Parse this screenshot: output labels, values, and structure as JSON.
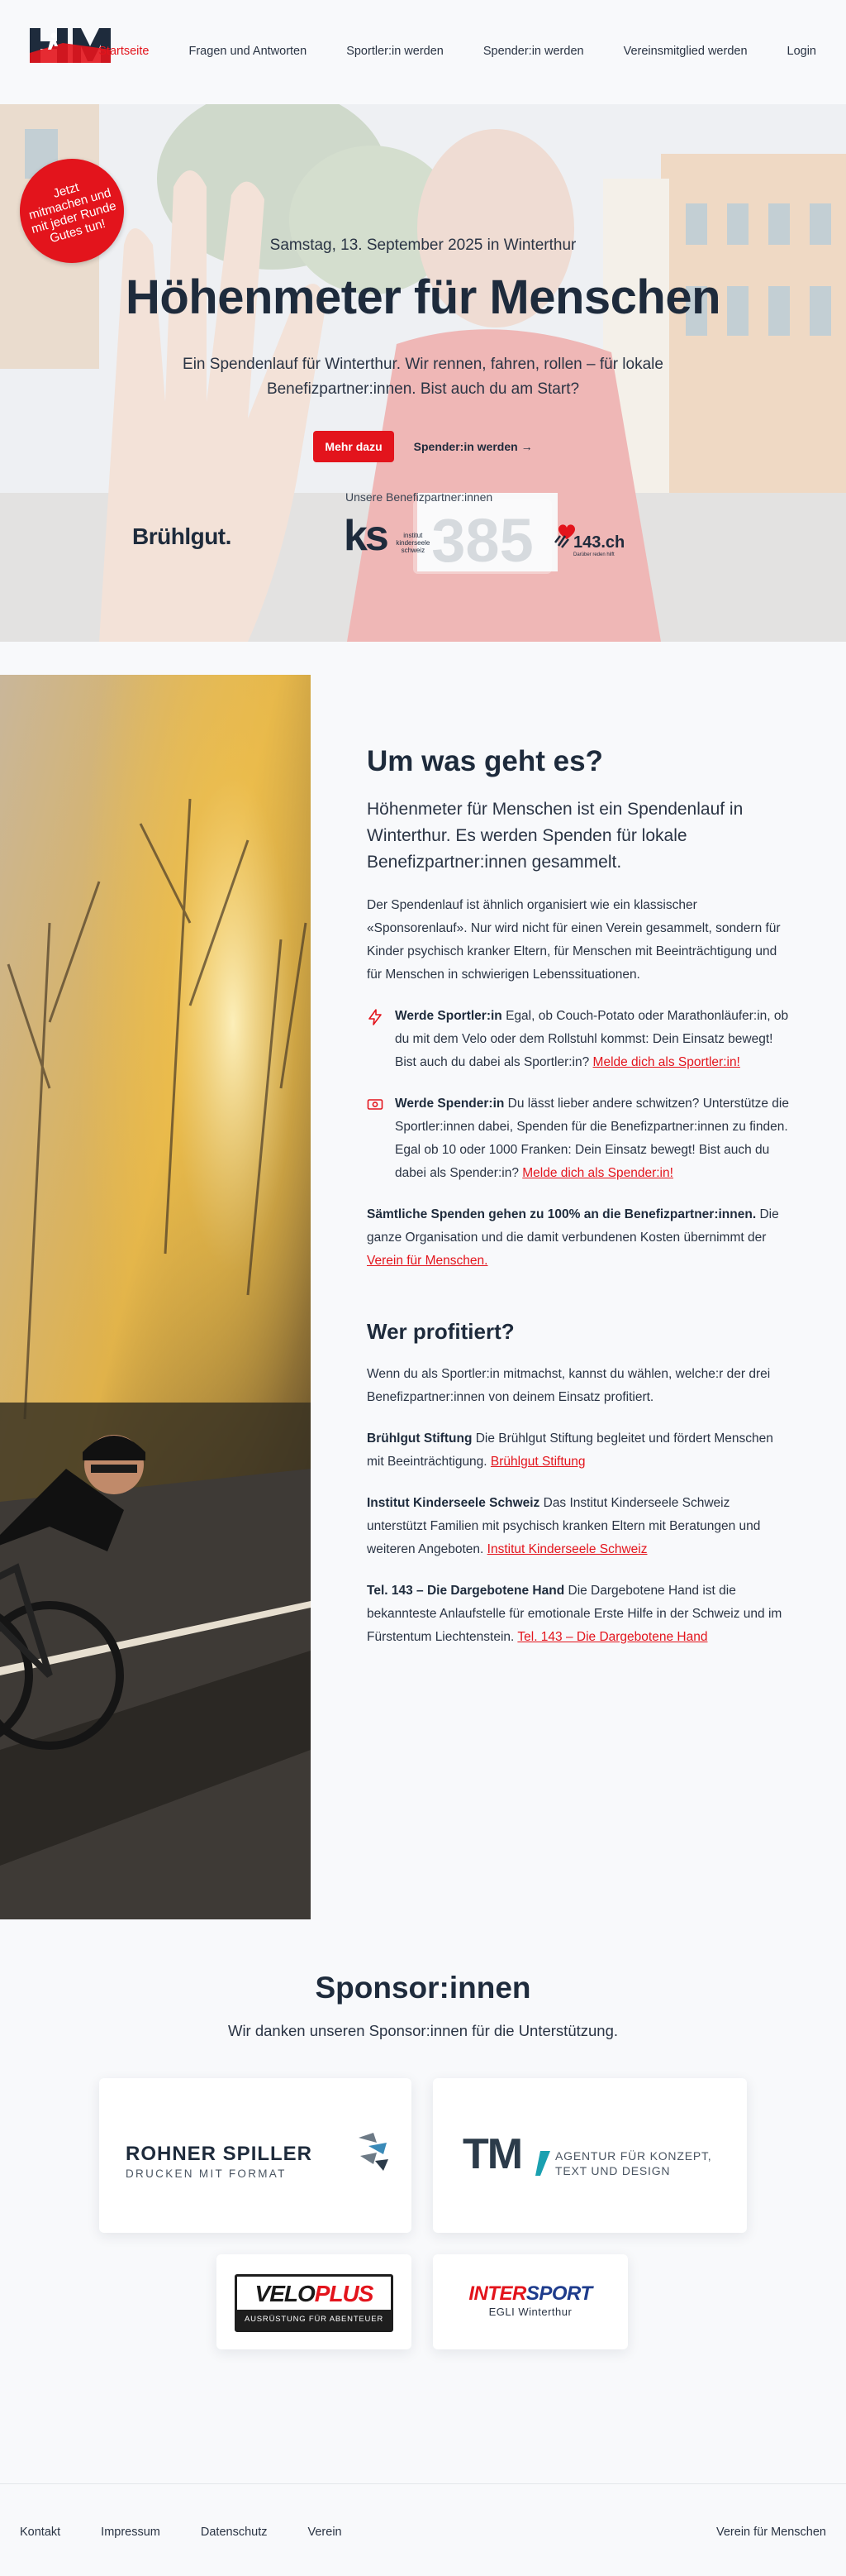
{
  "nav": {
    "logo_icon": "hfm-logo",
    "links": [
      "Startseite",
      "Fragen und Antworten",
      "Sportler:in werden",
      "Spender:in werden",
      "Vereinsmitglied werden",
      "Login"
    ],
    "active": "Startseite",
    "accent": "#e3141c"
  },
  "hero": {
    "badge": "Jetzt mitmachen und mit jeder Runde Gutes tun!",
    "date": "Samstag, 13. September 2025 in Winterthur",
    "title": "Höhenmeter für Menschen",
    "text": "Ein Spendenlauf für Winterthur. Wir rennen, fahren, rollen – für lokale Benefizpartner:innen. Bist auch du am Start?",
    "btn_primary": "Mehr dazu",
    "btn_secondary": "Spender:in werden →",
    "partners_label": "Unsere Benefizpartner:innen",
    "partner_bruehl": "Brühlgut.",
    "partner_ks_mark": "ks",
    "partner_ks_text": "institut kinderseele schweiz",
    "partner_143": "143.ch",
    "partner_143_sub": "Darüber reden hilft",
    "bib_number": "385"
  },
  "about": {
    "title": "Um was geht es?",
    "lead": "Höhenmeter für Menschen ist ein Spendenlauf in Winterthur. Es werden Spenden für lokale Benefizpartner:innen gesammelt.",
    "intro": "Der Spendenlauf ist ähnlich organisiert wie ein klassischer «Sponsorenlauf». Nur wird nicht für einen Verein gesammelt, sondern für Kinder psychisch kranker Eltern, für Menschen mit Beeinträchtigung und für Menschen in schwierigen Lebenssituationen.",
    "feature1_bold": "Werde Sportler:in",
    "feature1_text": " Egal, ob Couch-Potato oder Marathonläufer:in, ob du mit dem Velo oder dem Rollstuhl kommst: Dein Einsatz bewegt! Bist auch du dabei als Sportler:in? ",
    "feature1_link": "Melde dich als Sportler:in!",
    "feature2_bold": "Werde Spender:in",
    "feature2_text": " Du lässt lieber andere schwitzen? Unterstütze die Sportler:innen dabei, Spenden für die Benefizpartner:innen zu finden. Egal ob 10 oder 1000 Franken: Dein Einsatz bewegt! Bist auch du dabei als Spender:in? ",
    "feature2_link": "Melde dich als Spender:in!",
    "note_bold": "Sämtliche Spenden gehen zu 100% an die Benefizpartner:innen.",
    "note_text": " Die ganze Organisation und die damit verbundenen Kosten übernimmt der ",
    "note_link": "Verein für Menschen.",
    "who_title": "Wer profitiert?",
    "who_intro": "Wenn du als Sportler:in mitmachst, kannst du wählen, welche:r der drei Benefizpartner:innen von deinem Einsatz profitiert.",
    "p1_bold": "Brühlgut Stiftung",
    "p1_text": " Die Brühlgut Stiftung begleitet und fördert Menschen mit Beeinträchtigung. ",
    "p1_link": "Brühlgut Stiftung",
    "p2_bold": "Institut Kinderseele Schweiz",
    "p2_text": " Das Institut Kinderseele Schweiz unterstützt Familien mit psychisch kranken Eltern mit Beratungen und weiteren Angeboten. ",
    "p2_link": "Institut Kinderseele Schweiz",
    "p3_bold": "Tel. 143 – Die Dargebotene Hand",
    "p3_text": " Die Dargebotene Hand ist die bekannteste Anlaufstelle für emotionale Erste Hilfe in der Schweiz und im Fürstentum Liechtenstein. ",
    "p3_link": "Tel. 143 – Die Dargebotene Hand"
  },
  "sponsors": {
    "title": "Sponsor:innen",
    "subtitle": "Wir danken unseren Sponsor:innen für die Unterstützung.",
    "rohner_name": "ROHNER SPILLER",
    "rohner_sub": "DRUCKEN MIT FORMAT",
    "tm_mark": "TM",
    "tm_line1": "AGENTUR FÜR KONZEPT,",
    "tm_line2": "TEXT UND DESIGN",
    "velo_a": "VELO",
    "velo_b": "PLUS",
    "velo_sub": "AUSRÜSTUNG FÜR ABENTEUER",
    "inter_a": "INTER",
    "inter_b": "SPORT",
    "inter_sub": "EGLI Winterthur"
  },
  "footer": {
    "links": [
      "Kontakt",
      "Impressum",
      "Datenschutz",
      "Verein"
    ],
    "right": "Verein für Menschen"
  }
}
